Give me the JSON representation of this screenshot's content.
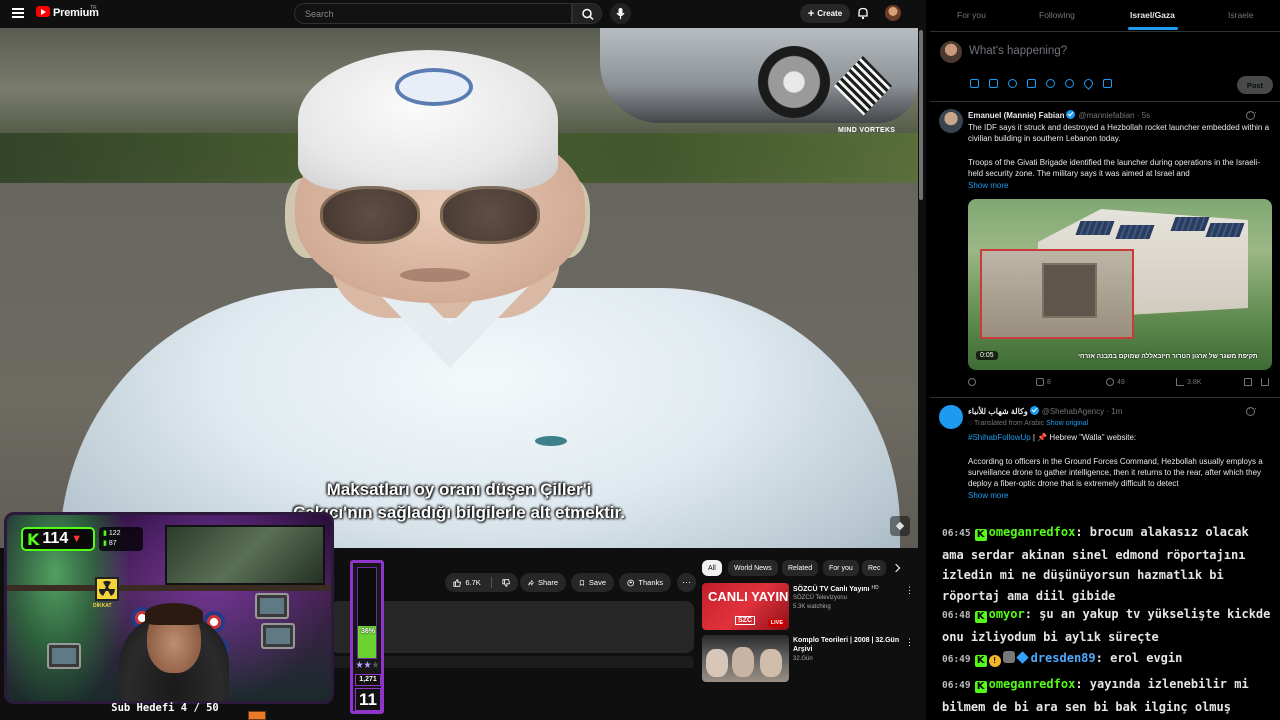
{
  "youtube": {
    "brand": "Premium",
    "brand_sup": "TR",
    "search_placeholder": "Search",
    "create_label": "Create",
    "video": {
      "watermark_text": "MIND VORTEKS",
      "subtitle_line1": "Maksatları oy oranı düşen Çiller'i",
      "subtitle_line2": "Çakıcı'nın sağladığı bilgilerle alt etmektir."
    },
    "actions": {
      "likes": "6.7K",
      "share": "Share",
      "save": "Save",
      "thanks": "Thanks",
      "more": "⋯"
    },
    "chips": [
      "All",
      "World News",
      "Related",
      "For you",
      "Rec"
    ],
    "recommendations": [
      {
        "title": "SÖZCÜ TV Canlı Yayını",
        "hd": "HD",
        "channel": "SÖZCÜ Televizyonu",
        "meta": "5.3K watching",
        "thumb_text": "CANLI YAYIN",
        "thumb_logo": "SZC",
        "live": "LIVE"
      },
      {
        "title": "Komplo Teorileri | 2008 | 32.Gün Arşivi",
        "channel": "32.Gün",
        "meta": ""
      }
    ]
  },
  "stream_overlay": {
    "kick_count": "114",
    "kick_stat_top": "122",
    "kick_stat_bottom": "87",
    "sub_goal_text": "Sub Hedefi 4 / 50",
    "meter": {
      "percent_label": "36%",
      "percent_value": 36,
      "stars_filled": 2,
      "stars_total": 3,
      "count": "1,271",
      "level": "11"
    },
    "radiation_label": "DİKKAT"
  },
  "x": {
    "tabs": [
      "For you",
      "Following",
      "Israel/Gaza",
      "Israele"
    ],
    "active_tab": "Israel/Gaza",
    "compose_placeholder": "What's happening?",
    "post_label": "Post",
    "accent": "#1d9bf0",
    "tweets": [
      {
        "name": "Emanuel (Mannie) Fabian",
        "handle": "@manniefabian · 5s",
        "text1": "The IDF says it struck and destroyed a Hezbollah rocket launcher embedded within a civilian building in southern Lebanon today.",
        "text2": "Troops of the Givati Brigade identified the launcher during operations in the Israeli-held security zone. The military says it was aimed at Israel and",
        "show_more": "Show more",
        "media_time": "0:05",
        "media_caption": "תקיפת משגר של ארגון הטרור חיזבאללה שמוקם במבנה אזרחי",
        "replies": "",
        "reposts": "8",
        "likes": "49",
        "views": "3.8K"
      },
      {
        "name": "وكالة شهاب للأنباء",
        "handle": "@ShehabAgency · 1m",
        "translated_prefix": "Translated from Arabic",
        "translated_link": "Show original",
        "hashtag": "#ShihabFollowUp",
        "headline": " | 📌 Hebrew \"Walla\" website:",
        "text": "According to officers in the Ground Forces Command, Hezbollah usually employs a surveillance drone to gather intelligence, then it returns to the rear, after which they deploy a fiber-optic drone that is extremely difficult to detect",
        "show_more": "Show more"
      }
    ]
  },
  "chat": {
    "accent": "#53fc18",
    "messages": [
      {
        "time": "06:45",
        "user": "omeganredfox",
        "text": "brocum alakasız olacak ama serdar akinan sinel edmond röportajını izledin mi ne düşünüyorsun hazmatlık bi röportaj ama diil gibide"
      },
      {
        "time": "06:48",
        "user": "omyor",
        "text": "şu an yakup tv yükselişte kickde onu izliyodum bi aylık süreçte"
      },
      {
        "time": "06:49",
        "user": "dresden89",
        "text": "erol evgin"
      },
      {
        "time": "06:49",
        "user": "omeganredfox",
        "text": "yayında izlenebilir mi bilmem de bi ara sen bi bak ilginç olmuş"
      }
    ]
  }
}
